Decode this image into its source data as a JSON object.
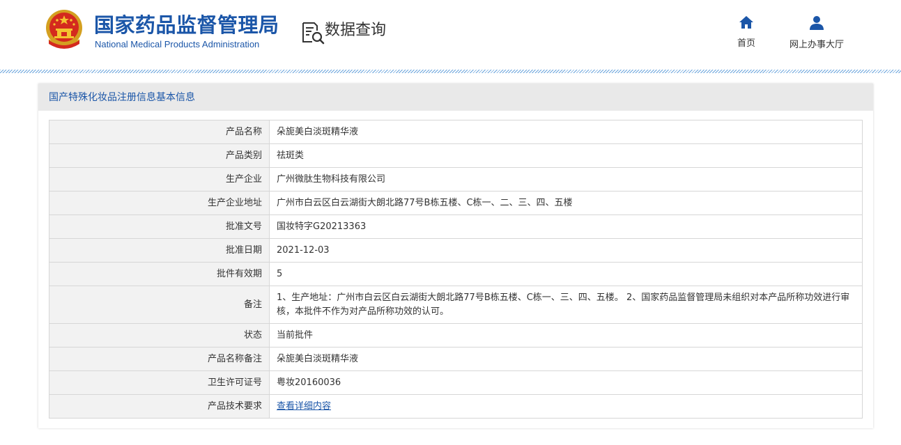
{
  "header": {
    "org_name_cn": "国家药品监督管理局",
    "org_name_en": "National Medical Products Administration",
    "section_title": "数据查询",
    "nav": [
      {
        "label": "首页",
        "icon": "home-icon"
      },
      {
        "label": "网上办事大厅",
        "icon": "user-icon"
      }
    ]
  },
  "colors": {
    "brand_blue": "#1b56a8",
    "link_blue": "#1b56a8",
    "header_bar": "#e9e9e9"
  },
  "panel": {
    "title": "国产特殊化妆品注册信息基本信息",
    "rows": [
      {
        "label": "产品名称",
        "value": "朵旎美白淡斑精华液"
      },
      {
        "label": "产品类别",
        "value": "祛斑类"
      },
      {
        "label": "生产企业",
        "value": "广州微肽生物科技有限公司"
      },
      {
        "label": "生产企业地址",
        "value": "广州市白云区白云湖街大朗北路77号B栋五楼、C栋一、二、三、四、五楼"
      },
      {
        "label": "批准文号",
        "value": "国妆特字G20213363"
      },
      {
        "label": "批准日期",
        "value": "2021-12-03"
      },
      {
        "label": "批件有效期",
        "value": "5"
      },
      {
        "label": "备注",
        "value": "1、生产地址：广州市白云区白云湖街大朗北路77号B栋五楼、C栋一、三、四、五楼。 2、国家药品监督管理局未组织对本产品所称功效进行审核，本批件不作为对产品所称功效的认可。"
      },
      {
        "label": "状态",
        "value": "当前批件"
      },
      {
        "label": "产品名称备注",
        "value": "朵旎美白淡斑精华液"
      },
      {
        "label": "卫生许可证号",
        "value": "粤妆20160036"
      },
      {
        "label": "产品技术要求",
        "value": "查看详细内容"
      }
    ]
  }
}
